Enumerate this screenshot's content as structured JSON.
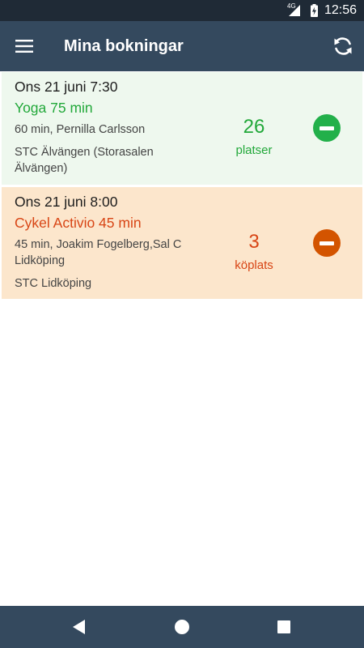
{
  "status_bar": {
    "network": "4G",
    "time": "12:56",
    "icons": [
      "signal-icon",
      "battery-charging-icon"
    ]
  },
  "app_bar": {
    "title": "Mina bokningar",
    "icons": [
      "menu-icon",
      "refresh-icon"
    ]
  },
  "bookings": [
    {
      "date": "Ons 21 juni 7:30",
      "class_name": "Yoga 75 min",
      "description": "60 min, Pernilla Carlsson",
      "location": "STC Älvängen  (Storasalen Älvängen)",
      "count": "26",
      "count_unit": "platser",
      "accent_color": "#22a83a",
      "icon": "remove-booking-icon"
    },
    {
      "date": "Ons 21 juni 8:00",
      "class_name": "Cykel Activio 45 min",
      "description": "45 min, Joakim Fogelberg,Sal C Lidköping",
      "location": "STC Lidköping",
      "count": "3",
      "count_unit": "köplats",
      "accent_color": "#d84515",
      "icon": "remove-booking-icon"
    }
  ],
  "colors": {
    "app_bar": "#34495e",
    "status_bar": "#1f2a36",
    "booked_bg": "#eef8ee",
    "queued_bg": "#fce6cc"
  },
  "nav_bar": {
    "icons": [
      "back-icon",
      "home-icon",
      "recents-icon"
    ]
  }
}
